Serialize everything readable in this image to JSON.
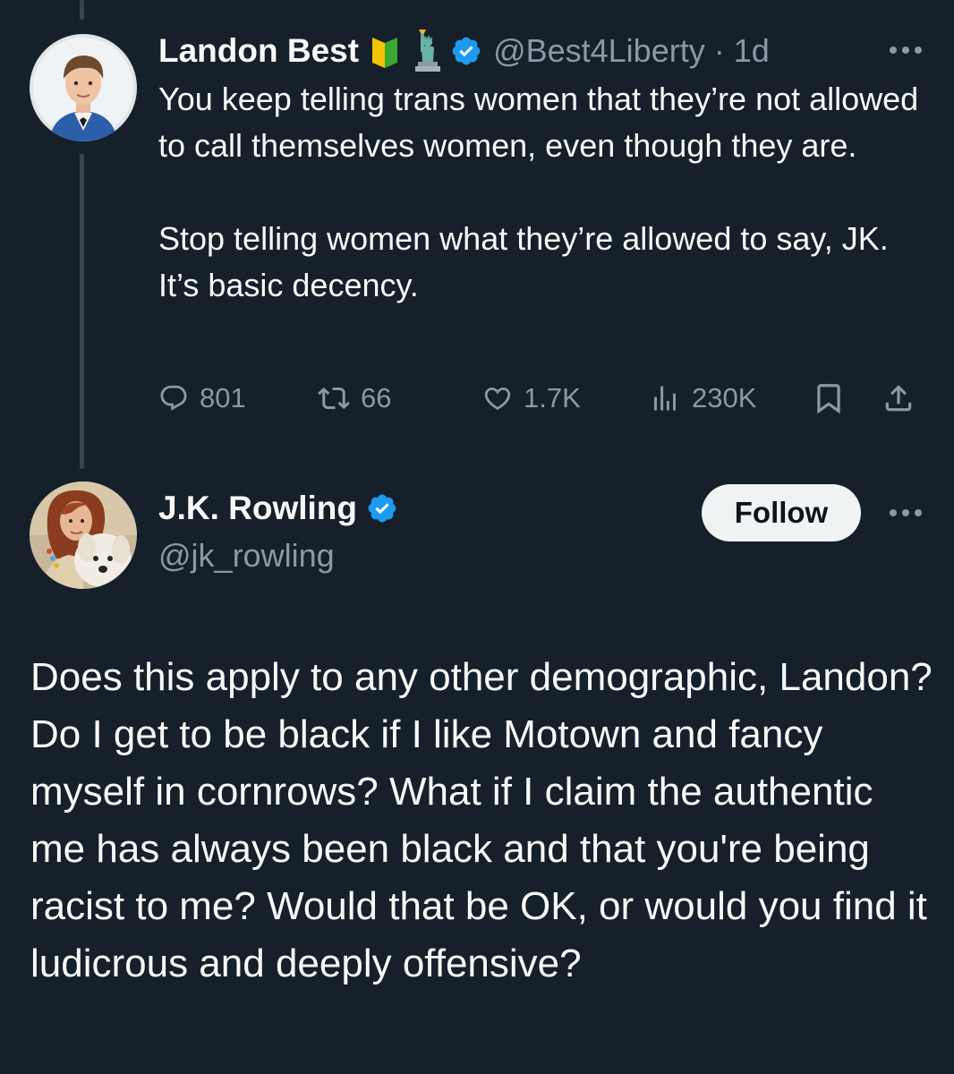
{
  "parent_tweet": {
    "author": {
      "display_name": "Landon Best",
      "badges": [
        "japanese-beginner-symbol-icon",
        "statue-of-liberty-icon",
        "verified-badge-icon"
      ],
      "handle": "@Best4Liberty",
      "separator": " · ",
      "time": "1d"
    },
    "text_paragraphs": [
      "You keep telling trans women that they’re not allowed to call themselves women, even though they are.",
      "Stop telling women what they’re allowed to say, JK. It’s basic decency."
    ],
    "stats": {
      "replies": "801",
      "retweets": "66",
      "likes": "1.7K",
      "views": "230K"
    }
  },
  "reply_tweet": {
    "author": {
      "display_name": "J.K. Rowling",
      "handle": "@jk_rowling",
      "verified": true
    },
    "follow_label": "Follow",
    "text": "Does this apply to any other demographic, Landon? Do I get to be black if I like Motown and fancy myself in cornrows? What if I claim the authentic me has always been black and that you're being racist to me? Would that be OK, or would you find it ludicrous and deeply offensive?"
  },
  "colors": {
    "background": "#15202b",
    "primary_text": "#f7f9f9",
    "secondary_text": "#8b98a5",
    "verified_blue": "#1d9bf0",
    "follow_button_bg": "#eff3f4",
    "thread_line": "#38444d"
  },
  "icons": {
    "more": "more-horizontal-icon",
    "reply": "reply-bubble-icon",
    "retweet": "retweet-icon",
    "like": "heart-icon",
    "views": "analytics-bars-icon",
    "bookmark": "bookmark-icon",
    "share": "share-upload-icon"
  }
}
